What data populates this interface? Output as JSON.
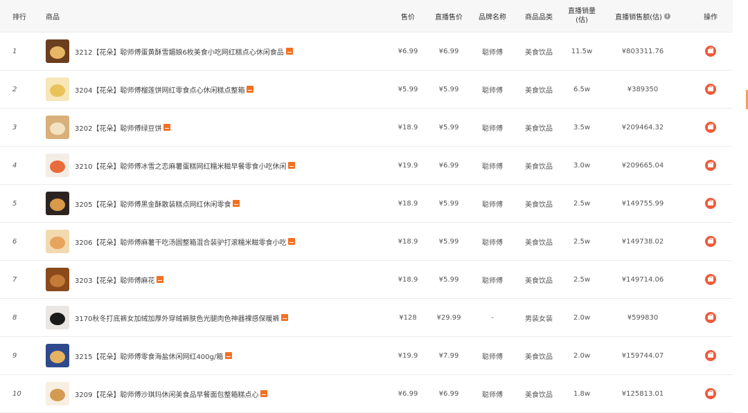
{
  "headers": {
    "rank": "排行",
    "product": "商品",
    "price": "售价",
    "live_price": "直播售价",
    "brand": "品牌名称",
    "category": "商品品类",
    "live_sales_line1": "直播销量",
    "live_sales_line2": "(估)",
    "live_amount": "直播销售额(估)",
    "info_icon": "i",
    "operation": "操作"
  },
  "rows": [
    {
      "rank": "1",
      "title": "3212【花朵】聪师傅蛋黄酥雪媚娘6枚美食小吃网红糕点心休闲食品",
      "price": "¥6.99",
      "live_price": "¥6.99",
      "brand": "聪师傅",
      "category": "美食饮品",
      "sales": "11.5w",
      "amount": "¥803311.76"
    },
    {
      "rank": "2",
      "title": "3204【花朵】聪师傅榴莲饼网红零食点心休闲糕点整箱",
      "price": "¥5.99",
      "live_price": "¥5.99",
      "brand": "聪师傅",
      "category": "美食饮品",
      "sales": "6.5w",
      "amount": "¥389350"
    },
    {
      "rank": "3",
      "title": "3202【花朵】聪师傅绿豆饼",
      "price": "¥18.9",
      "live_price": "¥5.99",
      "brand": "聪师傅",
      "category": "美食饮品",
      "sales": "3.5w",
      "amount": "¥209464.32"
    },
    {
      "rank": "4",
      "title": "3210【花朵】聪师傅冰雪之恋麻薯蛋糕网红糯米糍早餐零食小吃休闲",
      "price": "¥19.9",
      "live_price": "¥6.99",
      "brand": "聪师傅",
      "category": "美食饮品",
      "sales": "3.0w",
      "amount": "¥209665.04"
    },
    {
      "rank": "5",
      "title": "3205【花朵】聪师傅黑金酥散装糕点网红休闲零食",
      "price": "¥18.9",
      "live_price": "¥5.99",
      "brand": "聪师傅",
      "category": "美食饮品",
      "sales": "2.5w",
      "amount": "¥149755.99"
    },
    {
      "rank": "6",
      "title": "3206【花朵】聪师傅麻薯干吃汤圆整箱混合装驴打滚糯米糍零食小吃",
      "price": "¥18.9",
      "live_price": "¥5.99",
      "brand": "聪师傅",
      "category": "美食饮品",
      "sales": "2.5w",
      "amount": "¥149738.02"
    },
    {
      "rank": "7",
      "title": "3203【花朵】聪师傅麻花",
      "price": "¥18.9",
      "live_price": "¥5.99",
      "brand": "聪师傅",
      "category": "美食饮品",
      "sales": "2.5w",
      "amount": "¥149714.06"
    },
    {
      "rank": "8",
      "title": "3170秋冬打底裤女加绒加厚外穿绒裤肤色光腿肉色神器裸感保暖裤",
      "price": "¥128",
      "live_price": "¥29.99",
      "brand": "-",
      "category": "男装女装",
      "sales": "2.0w",
      "amount": "¥599830"
    },
    {
      "rank": "9",
      "title": "3215【花朵】聪师傅零食海盐休闲网红400g/箱",
      "price": "¥19.9",
      "live_price": "¥7.99",
      "brand": "聪师傅",
      "category": "美食饮品",
      "sales": "2.0w",
      "amount": "¥159744.07"
    },
    {
      "rank": "10",
      "title": "3209【花朵】聪师傅沙琪玛休闲美食品早餐面包整箱糕点心",
      "price": "¥6.99",
      "live_price": "¥6.99",
      "brand": "聪师傅",
      "category": "美食饮品",
      "sales": "1.8w",
      "amount": "¥125813.01"
    }
  ],
  "thumb_colors": [
    [
      "#6b3e1f",
      "#e7b766"
    ],
    [
      "#f6e6b8",
      "#e9c25a"
    ],
    [
      "#d9b07a",
      "#f3e2c2"
    ],
    [
      "#f3ede6",
      "#e96a3a"
    ],
    [
      "#2b2420",
      "#d99a4a"
    ],
    [
      "#f1d9b0",
      "#e8a35c"
    ],
    [
      "#8a4a1c",
      "#c57a38"
    ],
    [
      "#e9e6e3",
      "#1a1a1a"
    ],
    [
      "#2f4a8c",
      "#e6b360"
    ],
    [
      "#f7efe2",
      "#d59a52"
    ]
  ],
  "colors": {
    "accent": "#f05a3a",
    "badge": "#f37021"
  }
}
